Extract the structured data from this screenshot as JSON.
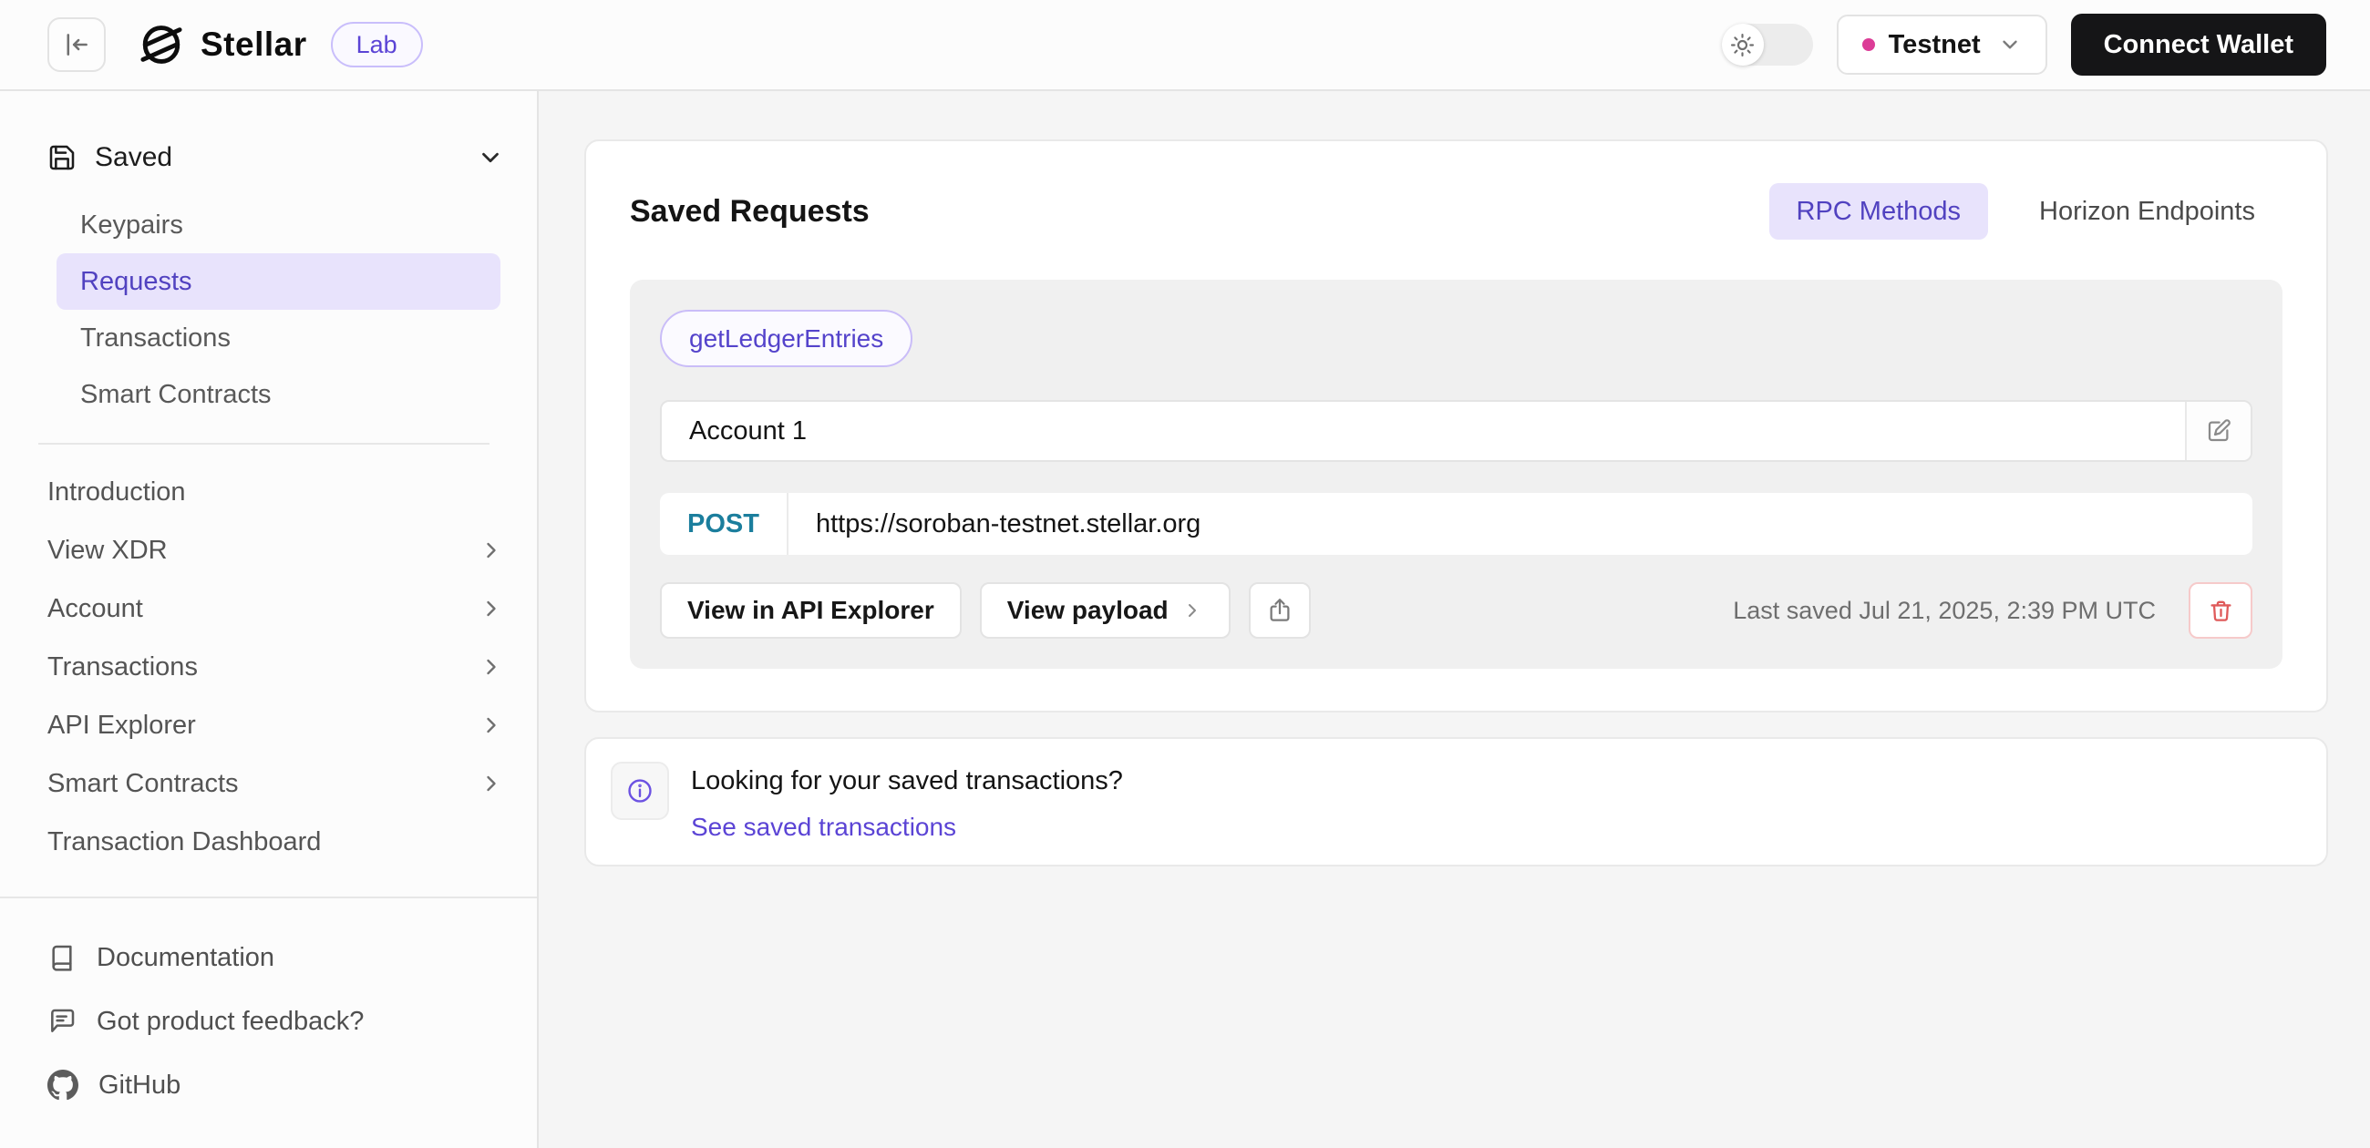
{
  "header": {
    "brand": "Stellar",
    "badge": "Lab",
    "network_label": "Testnet",
    "connect_wallet_label": "Connect Wallet"
  },
  "sidebar": {
    "saved": {
      "label": "Saved",
      "items": [
        {
          "label": "Keypairs",
          "selected": false
        },
        {
          "label": "Requests",
          "selected": true
        },
        {
          "label": "Transactions",
          "selected": false
        },
        {
          "label": "Smart Contracts",
          "selected": false
        }
      ]
    },
    "nav": [
      {
        "label": "Introduction",
        "has_submenu": false
      },
      {
        "label": "View XDR",
        "has_submenu": true
      },
      {
        "label": "Account",
        "has_submenu": true
      },
      {
        "label": "Transactions",
        "has_submenu": true
      },
      {
        "label": "API Explorer",
        "has_submenu": true
      },
      {
        "label": "Smart Contracts",
        "has_submenu": true
      },
      {
        "label": "Transaction Dashboard",
        "has_submenu": false
      }
    ],
    "footer": [
      {
        "label": "Documentation",
        "icon": "book-icon"
      },
      {
        "label": "Got product feedback?",
        "icon": "feedback-bubble-icon"
      },
      {
        "label": "GitHub",
        "icon": "github-icon"
      }
    ]
  },
  "main": {
    "title": "Saved Requests",
    "tabs": [
      {
        "label": "RPC Methods",
        "active": true
      },
      {
        "label": "Horizon Endpoints",
        "active": false
      }
    ],
    "request": {
      "method_badge": "getLedgerEntries",
      "name_value": "Account 1",
      "http_method": "POST",
      "url": "https://soroban-testnet.stellar.org",
      "view_api_explorer_label": "View in API Explorer",
      "view_payload_label": "View payload",
      "last_saved": "Last saved Jul 21, 2025, 2:39 PM UTC"
    },
    "info": {
      "title": "Looking for your saved transactions?",
      "link_label": "See saved transactions"
    }
  },
  "icons": {
    "header": [
      "collapse-sidebar-icon",
      "stellar-logo",
      "sun-icon",
      "chevron-down-icon"
    ],
    "request": [
      "edit-icon",
      "share-icon",
      "trash-icon",
      "chevron-right-icon"
    ],
    "info": [
      "info-icon"
    ]
  },
  "colors": {
    "accent_purple": "#5142c0",
    "accent_purple_bg": "#e8e3fc",
    "link_purple": "#5b44d5",
    "post_teal": "#1b7e9d",
    "danger_red": "#df5a5a",
    "danger_border": "#f6caca",
    "network_dot_pink": "#dc3c97",
    "header_bg": "#fcfcfc",
    "page_bg": "#f5f5f5",
    "inner_card_bg": "#f0f0f0",
    "connect_btn_bg": "#151517"
  }
}
